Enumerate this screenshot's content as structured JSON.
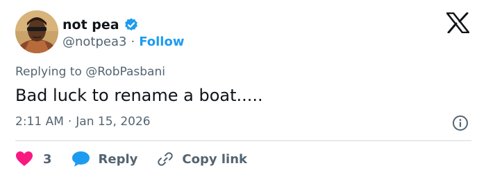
{
  "author": {
    "display_name": "not pea",
    "handle": "@notpea3",
    "separator": "·",
    "follow_label": "Follow",
    "verified": true
  },
  "reply_context": {
    "prefix": "Replying to",
    "mention": "@RobPasbani"
  },
  "tweet": {
    "text": "Bad luck to rename a boat.....",
    "time": "2:11 AM",
    "separator": "·",
    "date": "Jan 15, 2026"
  },
  "actions": {
    "like_count": "3",
    "reply_label": "Reply",
    "copy_label": "Copy link"
  },
  "colors": {
    "accent": "#1d9bf0",
    "like": "#f91880",
    "text": "#0f1419",
    "secondary": "#536471",
    "divider": "#cfd9de"
  },
  "icons": {
    "verified": "verified-badge-icon",
    "logo": "x-logo-icon",
    "info": "info-icon",
    "like": "heart-icon",
    "reply": "speech-bubble-icon",
    "copy": "link-icon"
  }
}
